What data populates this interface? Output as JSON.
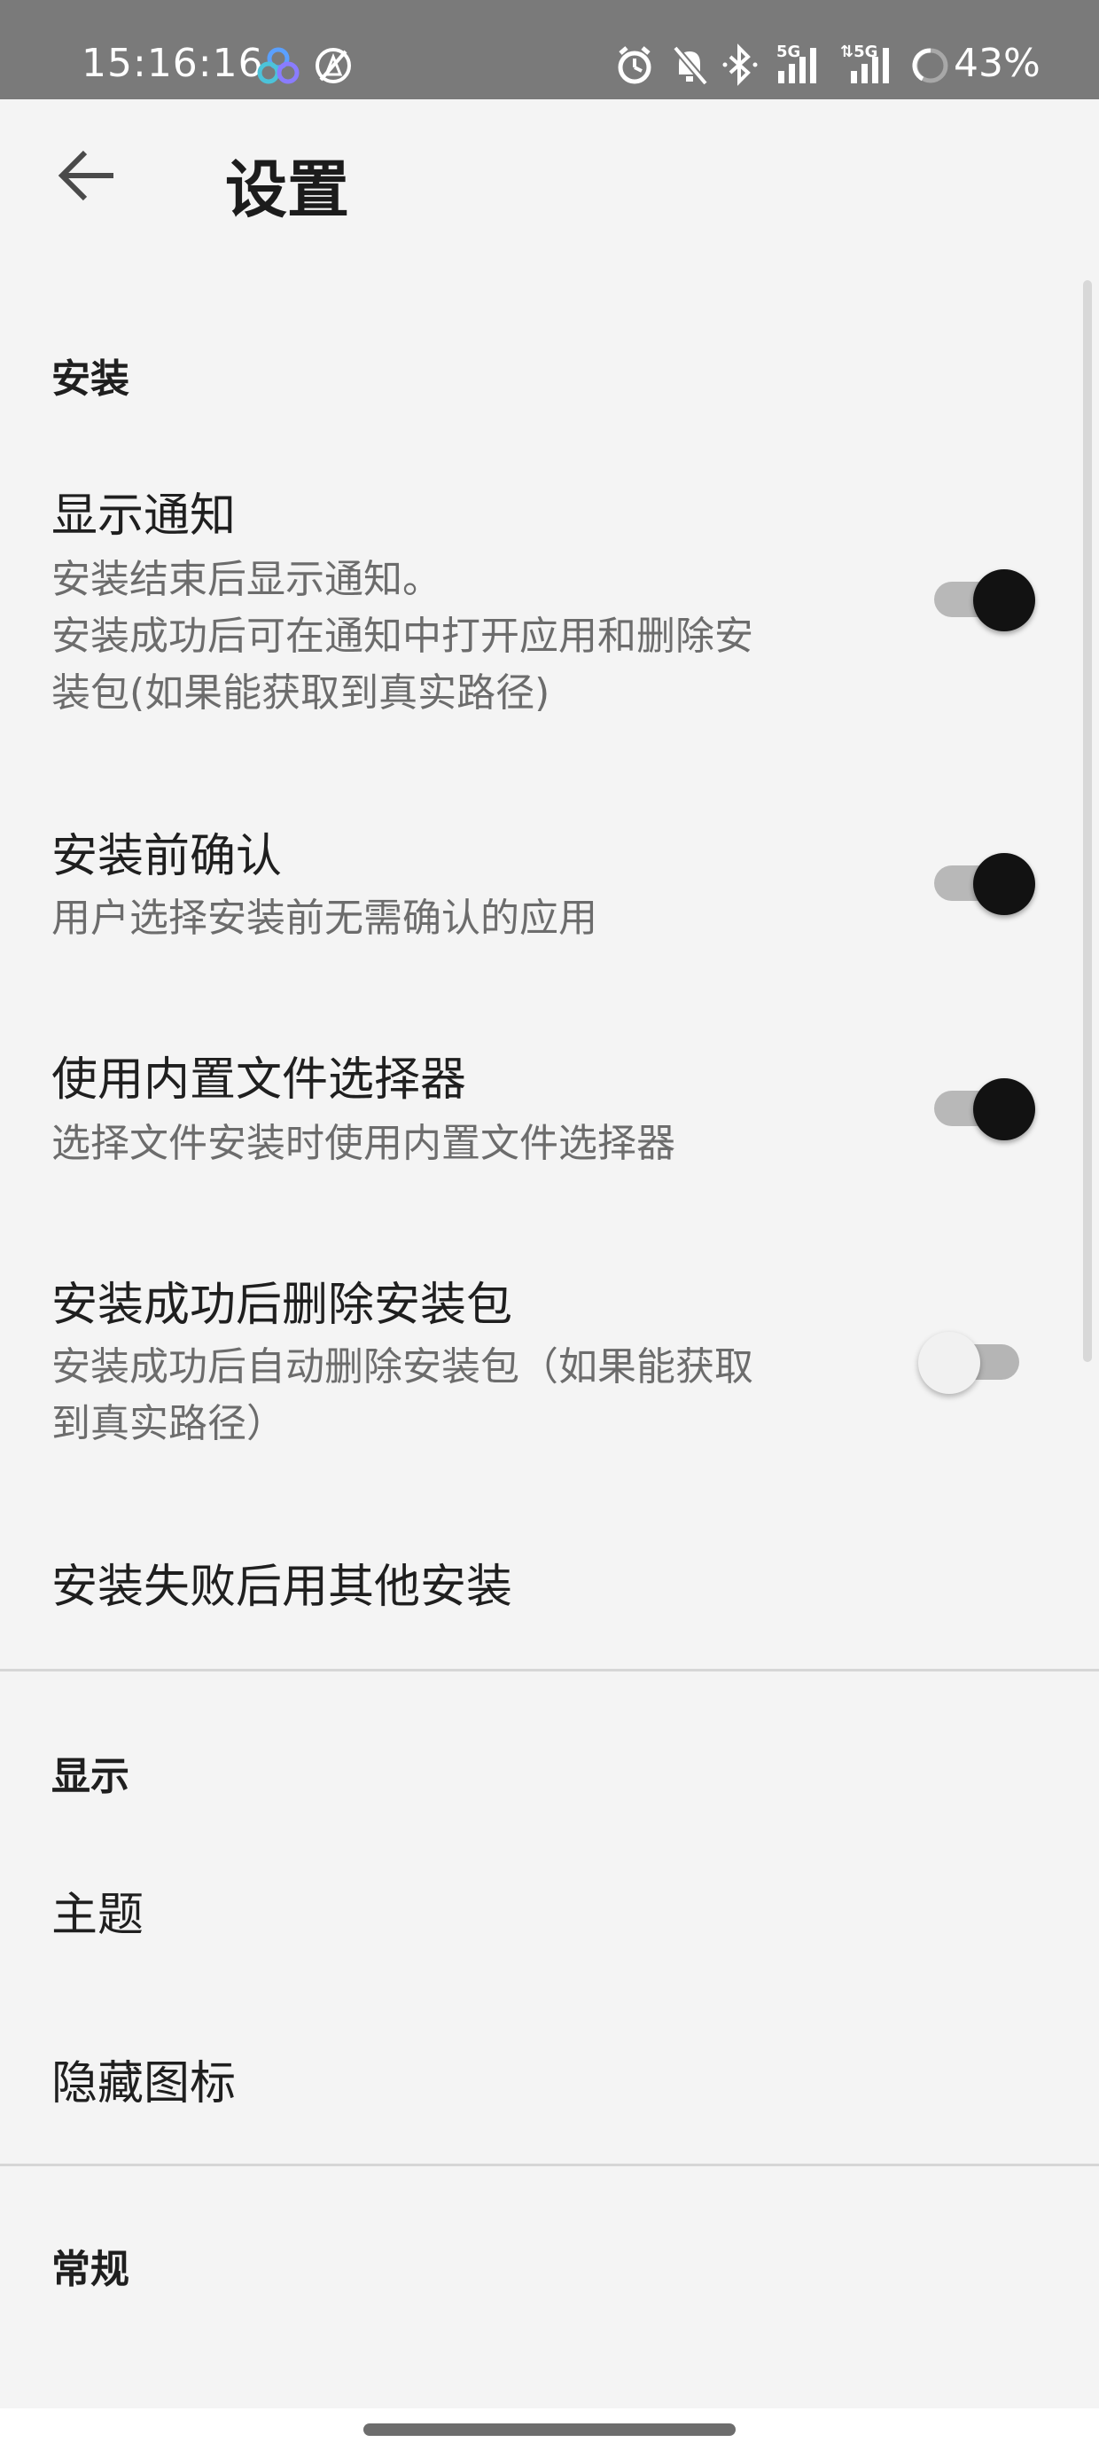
{
  "status_bar": {
    "time": "15:16:16",
    "battery_percent": "43%",
    "icons": [
      "app-cloud-icon",
      "no-location-icon",
      "alarm-icon",
      "mute-icon",
      "bluetooth-icon",
      "signal-5g-1-icon",
      "signal-5g-2-icon",
      "battery-ring-icon"
    ]
  },
  "app_bar": {
    "title": "设置",
    "back_icon": "arrow-back-icon"
  },
  "sections": {
    "install": {
      "header": "安装",
      "items": [
        {
          "title": "显示通知",
          "summary_lines": [
            "安装结束后显示通知。",
            "安装成功后可在通知中打开应用和删除安",
            "装包(如果能获取到真实路径)"
          ],
          "switch_on": true
        },
        {
          "title": "安装前确认",
          "summary_lines": [
            "用户选择安装前无需确认的应用"
          ],
          "switch_on": true
        },
        {
          "title": "使用内置文件选择器",
          "summary_lines": [
            "选择文件安装时使用内置文件选择器"
          ],
          "switch_on": true
        },
        {
          "title": "安装成功后删除安装包",
          "summary_lines": [
            "安装成功后自动删除安装包（如果能获取",
            "到真实路径）"
          ],
          "switch_on": false
        },
        {
          "title": "安装失败后用其他安装"
        }
      ]
    },
    "display": {
      "header": "显示",
      "items": [
        {
          "title": "主题"
        },
        {
          "title": "隐藏图标"
        }
      ]
    },
    "general": {
      "header": "常规"
    }
  },
  "colors": {
    "status_bar": "#7a7a7a",
    "background": "#f4f4f4",
    "switch_on_thumb": "#121212",
    "switch_track": "#b8b8b8",
    "summary_text": "#6c6c6c"
  }
}
